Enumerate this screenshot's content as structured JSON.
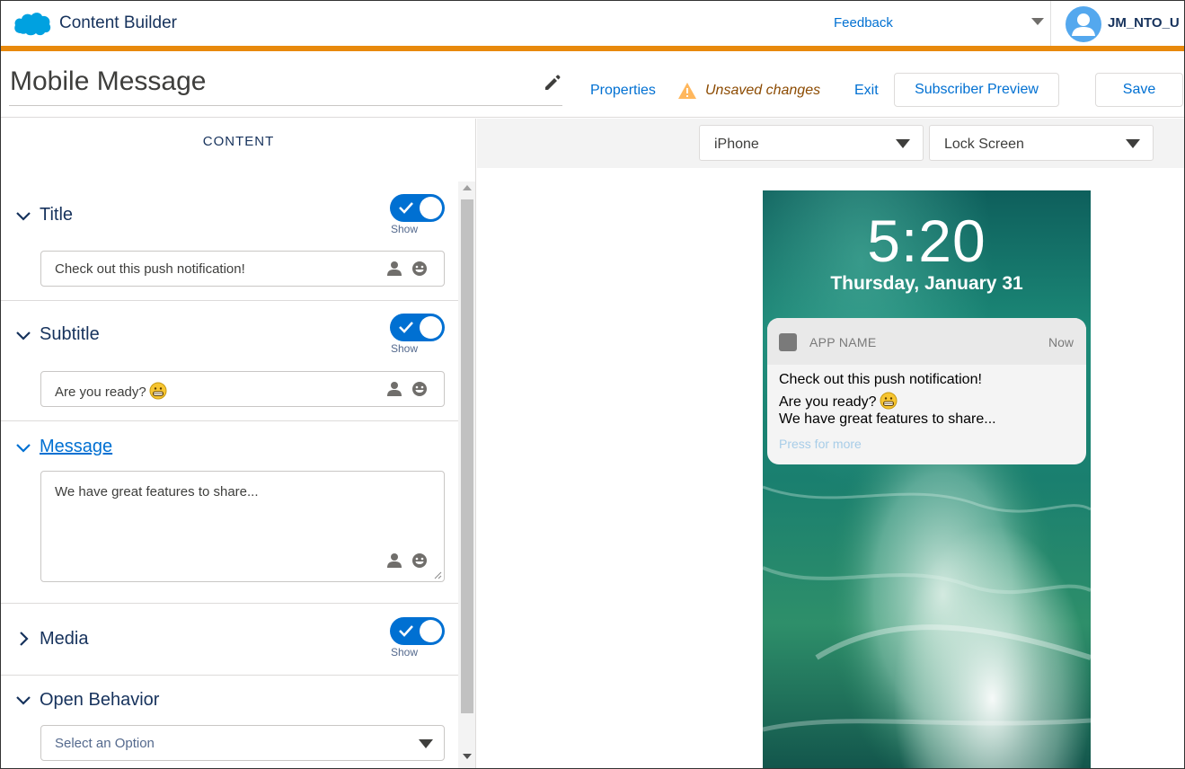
{
  "app": {
    "name": "Content Builder",
    "feedback_label": "Feedback",
    "username": "JM_NTO_U"
  },
  "editor": {
    "title": "Mobile Message",
    "properties_label": "Properties",
    "unsaved_label": "Unsaved changes",
    "exit_label": "Exit",
    "preview_label": "Subscriber Preview",
    "save_label": "Save"
  },
  "content_panel": {
    "header": "CONTENT",
    "toggle_label": "Show",
    "title_section": {
      "label": "Title",
      "value": "Check out this push notification!",
      "shown": true
    },
    "subtitle_section": {
      "label": "Subtitle",
      "value": "Are you ready?",
      "shown": true
    },
    "message_section": {
      "label": "Message",
      "value": "We have great features to share..."
    },
    "media_section": {
      "label": "Media",
      "shown": true
    },
    "open_behavior_section": {
      "label": "Open Behavior",
      "placeholder": "Select an Option"
    }
  },
  "preview": {
    "device": "iPhone",
    "view": "Lock Screen",
    "time": "5:20",
    "date": "Thursday, January 31",
    "notification": {
      "app_name": "APP NAME",
      "timestamp": "Now",
      "title": "Check out this push notification!",
      "subtitle": "Are you ready?",
      "message": "We have great features to share...",
      "press_hint": "Press for more"
    }
  },
  "colors": {
    "accent": "#0070d2",
    "brand_strip": "#e8890c",
    "warning": "#ffb75d",
    "unsaved_text": "#8c4b02"
  },
  "icons": {
    "brand": "cloud-logo-icon",
    "edit": "pencil-icon",
    "warning": "warning-icon",
    "personalize": "person-icon",
    "emoji": "smiley-icon"
  }
}
